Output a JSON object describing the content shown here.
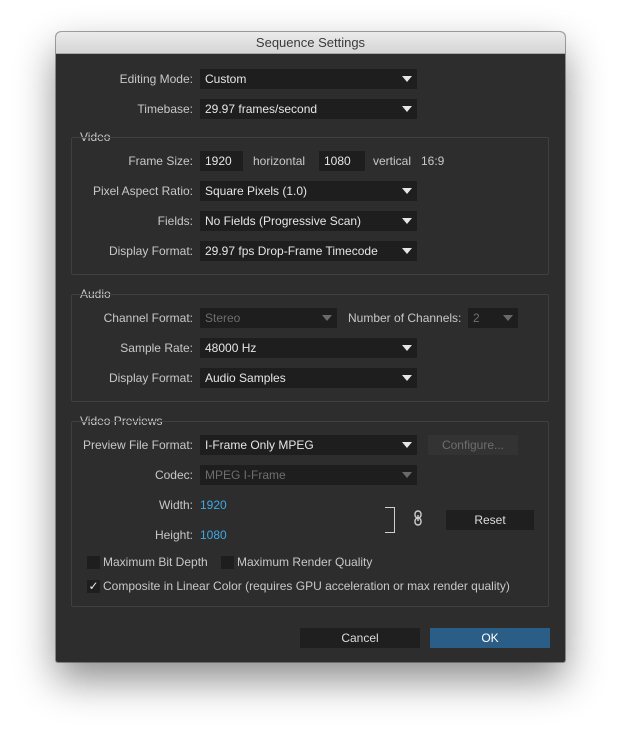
{
  "window": {
    "title": "Sequence Settings"
  },
  "general": {
    "editing_mode_label": "Editing Mode:",
    "editing_mode_value": "Custom",
    "timebase_label": "Timebase:",
    "timebase_value": "29.97  frames/second"
  },
  "video": {
    "section_title": "Video",
    "frame_size_label": "Frame Size:",
    "frame_width": "1920",
    "horizontal_label": "horizontal",
    "frame_height": "1080",
    "vertical_label": "vertical",
    "aspect_ratio": "16:9",
    "pixel_aspect_label": "Pixel Aspect Ratio:",
    "pixel_aspect_value": "Square Pixels (1.0)",
    "fields_label": "Fields:",
    "fields_value": "No Fields (Progressive Scan)",
    "display_format_label": "Display Format:",
    "display_format_value": "29.97 fps Drop-Frame Timecode"
  },
  "audio": {
    "section_title": "Audio",
    "channel_format_label": "Channel Format:",
    "channel_format_value": "Stereo",
    "num_channels_label": "Number of Channels:",
    "num_channels_value": "2",
    "sample_rate_label": "Sample Rate:",
    "sample_rate_value": "48000 Hz",
    "display_format_label": "Display Format:",
    "display_format_value": "Audio Samples"
  },
  "previews": {
    "section_title": "Video Previews",
    "preview_format_label": "Preview File Format:",
    "preview_format_value": "I-Frame Only MPEG",
    "configure_label": "Configure...",
    "codec_label": "Codec:",
    "codec_value": "MPEG I-Frame",
    "width_label": "Width:",
    "width_value": "1920",
    "height_label": "Height:",
    "height_value": "1080",
    "reset_label": "Reset",
    "max_bit_depth_label": "Maximum Bit Depth",
    "max_render_quality_label": "Maximum Render Quality",
    "linear_color_check": "✓",
    "linear_color_label": "Composite in Linear Color (requires GPU acceleration or max render quality)"
  },
  "footer": {
    "cancel_label": "Cancel",
    "ok_label": "OK"
  },
  "icons": {
    "link": "link-icon",
    "checkmark": "checkmark-icon"
  },
  "colors": {
    "accent": "#2b5e86",
    "value_blue": "#3fa9e6",
    "panel": "#2d2d2d"
  }
}
